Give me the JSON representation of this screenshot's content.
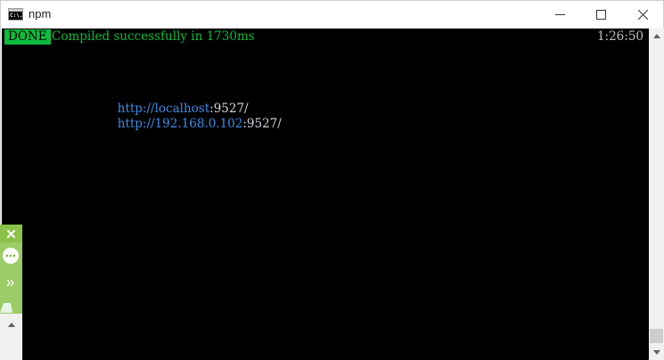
{
  "window": {
    "title": "npm",
    "icon": "console-icon",
    "icon_label": "C:\\."
  },
  "console": {
    "status_badge": "DONE",
    "compile_message": "Compiled successfully in 1730ms",
    "time": "1:26:50",
    "urls": [
      {
        "host": "http://localhost",
        "port": ":9527/"
      },
      {
        "host": "http://192.168.0.102",
        "port": ":9527/"
      }
    ]
  },
  "colors": {
    "success_green": "#0dbc3c",
    "url_blue": "#3b8eea",
    "toolbar_green": "#9ccc65"
  },
  "side_toolbar": {
    "icons": [
      "close-icon",
      "chat-bubble-icon",
      "double-chevron-right-icon",
      "tab-icon",
      "scroll-up-icon"
    ]
  }
}
